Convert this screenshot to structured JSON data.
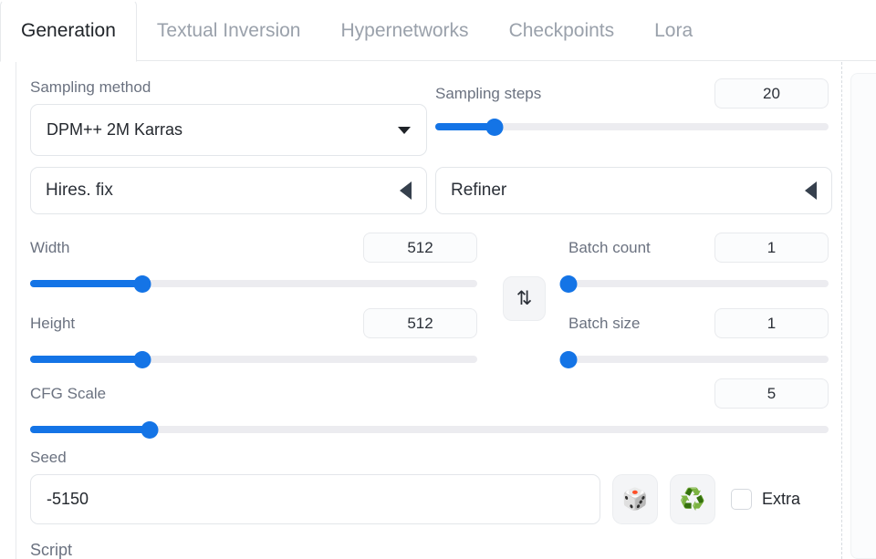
{
  "tabs": [
    {
      "label": "Generation",
      "active": true
    },
    {
      "label": "Textual Inversion",
      "active": false
    },
    {
      "label": "Hypernetworks",
      "active": false
    },
    {
      "label": "Checkpoints",
      "active": false
    },
    {
      "label": "Lora",
      "active": false
    }
  ],
  "sampling_method": {
    "label": "Sampling method",
    "value": "DPM++ 2M Karras",
    "caret_icon": "chevron-down-icon"
  },
  "sampling_steps": {
    "label": "Sampling steps",
    "value": "20",
    "percent": 15
  },
  "accordions": [
    {
      "label": "Hires. fix",
      "caret_icon": "triangle-left-icon",
      "expanded": false
    },
    {
      "label": "Refiner",
      "caret_icon": "triangle-left-icon",
      "expanded": false
    }
  ],
  "width": {
    "label": "Width",
    "value": "512",
    "percent": 25
  },
  "height": {
    "label": "Height",
    "value": "512",
    "percent": 25
  },
  "swap": {
    "icon": "swap-arrows-icon",
    "glyph": "⇅"
  },
  "batch_count": {
    "label": "Batch count",
    "value": "1",
    "percent": 0
  },
  "batch_size": {
    "label": "Batch size",
    "value": "1",
    "percent": 0
  },
  "cfg_scale": {
    "label": "CFG Scale",
    "value": "5",
    "percent": 15
  },
  "seed": {
    "label": "Seed",
    "value": "-5150",
    "random_button": {
      "icon": "dice-icon",
      "glyph": "🎲"
    },
    "reuse_button": {
      "icon": "recycle-icon",
      "glyph": "♻️"
    },
    "extra_checkbox": {
      "label": "Extra",
      "checked": false
    }
  },
  "script": {
    "label": "Script"
  },
  "colors": {
    "accent": "#1474e6",
    "track": "#ececf0",
    "label_text": "#6b7280",
    "value_text": "#24282e",
    "border": "#e3e6ea",
    "tab_inactive": "#9aa1ab"
  }
}
